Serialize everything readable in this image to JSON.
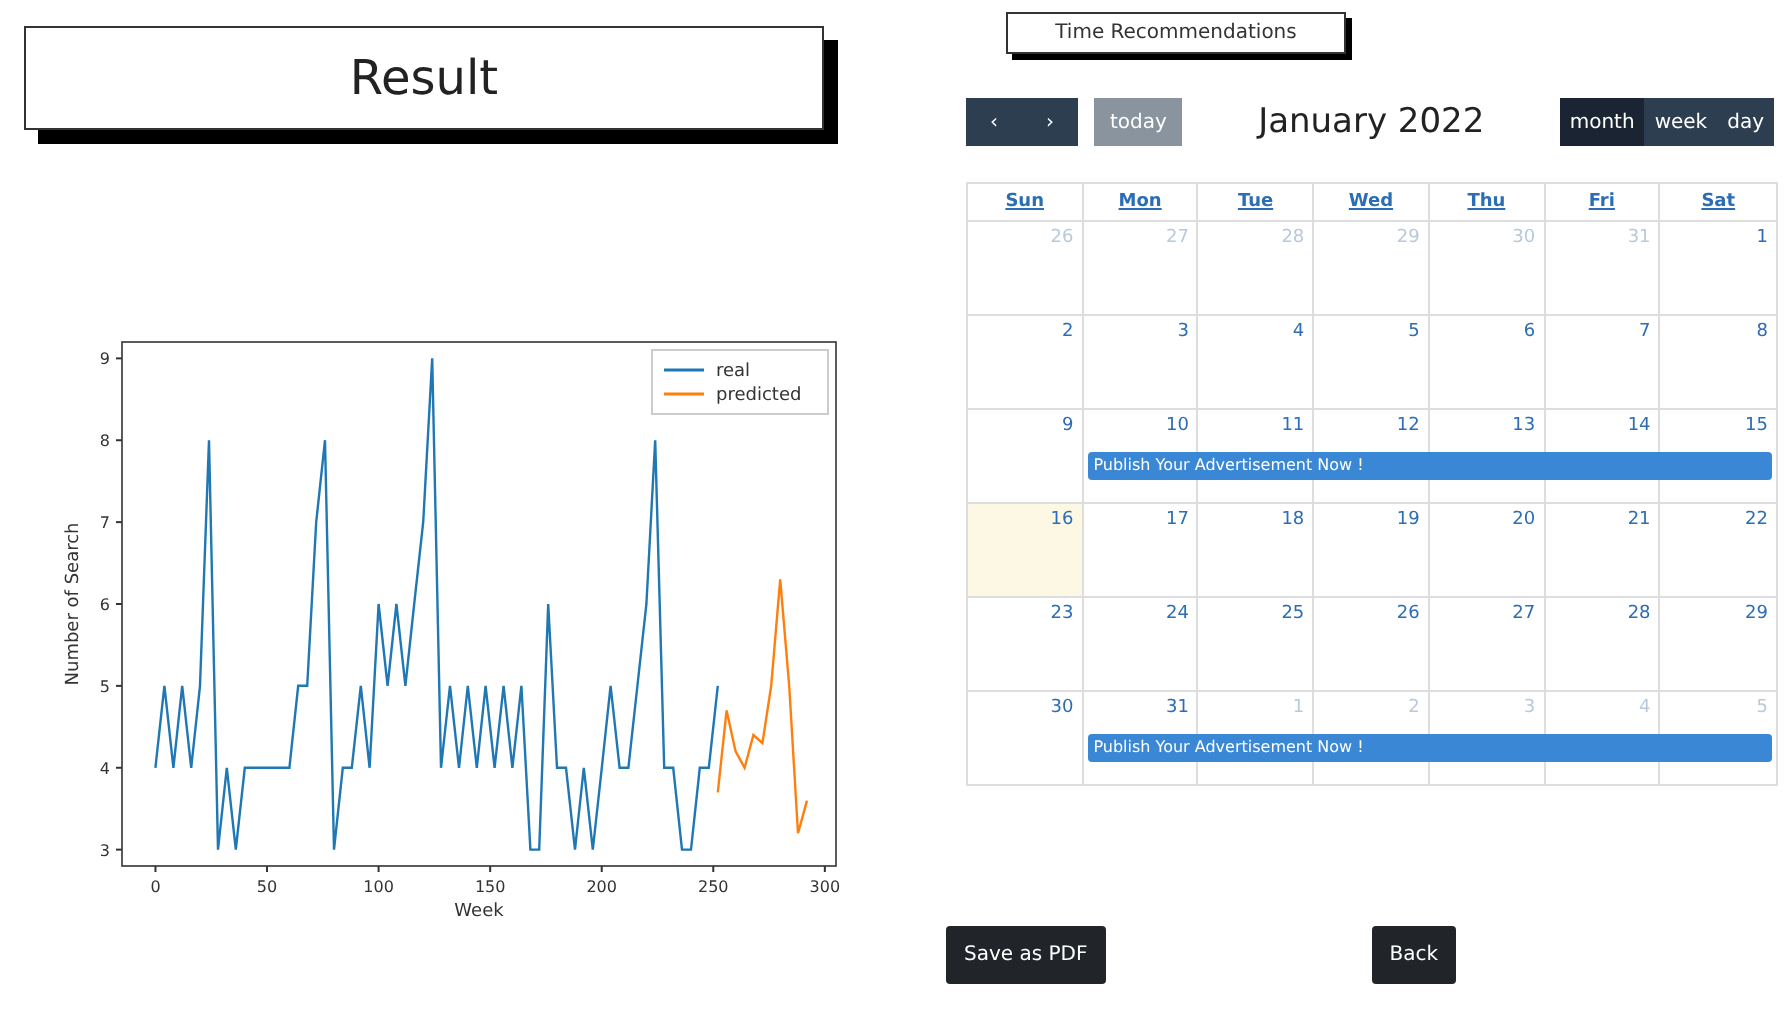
{
  "result_title": "Result",
  "chart": {
    "chart_data": {
      "type": "line",
      "xlabel": "Week",
      "ylabel": "Number of Search",
      "x": [
        0,
        4,
        8,
        12,
        16,
        20,
        24,
        28,
        32,
        36,
        40,
        44,
        48,
        52,
        56,
        60,
        64,
        68,
        72,
        76,
        80,
        84,
        88,
        92,
        96,
        100,
        104,
        108,
        112,
        116,
        120,
        124,
        128,
        132,
        136,
        140,
        144,
        148,
        152,
        156,
        160,
        164,
        168,
        172,
        176,
        180,
        184,
        188,
        192,
        196,
        200,
        204,
        208,
        212,
        216,
        220,
        224,
        228,
        232,
        236,
        240,
        244,
        248,
        252,
        256,
        260,
        264,
        268,
        272,
        276,
        280,
        284,
        288,
        292
      ],
      "series": [
        {
          "name": "real",
          "color": "#1f77b4",
          "values": [
            4,
            5,
            4,
            5,
            4,
            5,
            8,
            3,
            4,
            3,
            4,
            4,
            4,
            4,
            4,
            4,
            5,
            5,
            7,
            8,
            3,
            4,
            4,
            5,
            4,
            6,
            5,
            6,
            5,
            6,
            7,
            9,
            4,
            5,
            4,
            5,
            4,
            5,
            4,
            5,
            4,
            5,
            3,
            3,
            6,
            4,
            4,
            3,
            4,
            3,
            4,
            5,
            4,
            4,
            5,
            6,
            8,
            4,
            4,
            3,
            3,
            4,
            4,
            5,
            null,
            null,
            null,
            null,
            null,
            null,
            null,
            null,
            null,
            null
          ]
        },
        {
          "name": "predicted",
          "color": "#ff7f0e",
          "values": [
            null,
            null,
            null,
            null,
            null,
            null,
            null,
            null,
            null,
            null,
            null,
            null,
            null,
            null,
            null,
            null,
            null,
            null,
            null,
            null,
            null,
            null,
            null,
            null,
            null,
            null,
            null,
            null,
            null,
            null,
            null,
            null,
            null,
            null,
            null,
            null,
            null,
            null,
            null,
            null,
            null,
            null,
            null,
            null,
            null,
            null,
            null,
            null,
            null,
            null,
            null,
            null,
            null,
            null,
            null,
            null,
            null,
            null,
            null,
            null,
            null,
            null,
            null,
            3.7,
            4.7,
            4.2,
            4.0,
            4.4,
            4.3,
            5.0,
            6.3,
            5.0,
            3.2,
            3.6
          ]
        }
      ],
      "legend": "upper right",
      "xlim": [
        -15,
        305
      ],
      "ylim": [
        2.8,
        9.2
      ],
      "xticks": [
        0,
        50,
        100,
        150,
        200,
        250,
        300
      ],
      "yticks": [
        3,
        4,
        5,
        6,
        7,
        8,
        9
      ]
    }
  },
  "recommendations_button": "Time Recommendations",
  "calendar": {
    "prev": "‹",
    "next": "›",
    "today": {
      "label": "today",
      "disabled": true
    },
    "title": "January 2022",
    "views": [
      {
        "label": "month",
        "selected": true
      },
      {
        "label": "week",
        "selected": false
      },
      {
        "label": "day",
        "selected": false
      }
    ],
    "weekdays": [
      "Sun",
      "Mon",
      "Tue",
      "Wed",
      "Thu",
      "Fri",
      "Sat"
    ],
    "weeks": [
      {
        "days": [
          {
            "date": "26",
            "other_month": true,
            "today": false
          },
          {
            "date": "27",
            "other_month": true,
            "today": false
          },
          {
            "date": "28",
            "other_month": true,
            "today": false
          },
          {
            "date": "29",
            "other_month": true,
            "today": false
          },
          {
            "date": "30",
            "other_month": true,
            "today": false
          },
          {
            "date": "31",
            "other_month": true,
            "today": false
          },
          {
            "date": "1",
            "other_month": false,
            "today": false
          }
        ]
      },
      {
        "days": [
          {
            "date": "2",
            "other_month": false,
            "today": false
          },
          {
            "date": "3",
            "other_month": false,
            "today": false
          },
          {
            "date": "4",
            "other_month": false,
            "today": false
          },
          {
            "date": "5",
            "other_month": false,
            "today": false
          },
          {
            "date": "6",
            "other_month": false,
            "today": false
          },
          {
            "date": "7",
            "other_month": false,
            "today": false
          },
          {
            "date": "8",
            "other_month": false,
            "today": false
          }
        ]
      },
      {
        "days": [
          {
            "date": "9",
            "other_month": false,
            "today": false
          },
          {
            "date": "10",
            "other_month": false,
            "today": false,
            "event": "Publish Your Advertisement Now !"
          },
          {
            "date": "11",
            "other_month": false,
            "today": false
          },
          {
            "date": "12",
            "other_month": false,
            "today": false
          },
          {
            "date": "13",
            "other_month": false,
            "today": false
          },
          {
            "date": "14",
            "other_month": false,
            "today": false
          },
          {
            "date": "15",
            "other_month": false,
            "today": false
          }
        ]
      },
      {
        "days": [
          {
            "date": "16",
            "other_month": false,
            "today": true
          },
          {
            "date": "17",
            "other_month": false,
            "today": false
          },
          {
            "date": "18",
            "other_month": false,
            "today": false
          },
          {
            "date": "19",
            "other_month": false,
            "today": false
          },
          {
            "date": "20",
            "other_month": false,
            "today": false
          },
          {
            "date": "21",
            "other_month": false,
            "today": false
          },
          {
            "date": "22",
            "other_month": false,
            "today": false
          }
        ]
      },
      {
        "days": [
          {
            "date": "23",
            "other_month": false,
            "today": false
          },
          {
            "date": "24",
            "other_month": false,
            "today": false
          },
          {
            "date": "25",
            "other_month": false,
            "today": false
          },
          {
            "date": "26",
            "other_month": false,
            "today": false
          },
          {
            "date": "27",
            "other_month": false,
            "today": false
          },
          {
            "date": "28",
            "other_month": false,
            "today": false
          },
          {
            "date": "29",
            "other_month": false,
            "today": false
          }
        ]
      },
      {
        "days": [
          {
            "date": "30",
            "other_month": false,
            "today": false
          },
          {
            "date": "31",
            "other_month": false,
            "today": false,
            "event": "Publish Your Advertisement Now !"
          },
          {
            "date": "1",
            "other_month": true,
            "today": false
          },
          {
            "date": "2",
            "other_month": true,
            "today": false
          },
          {
            "date": "3",
            "other_month": true,
            "today": false
          },
          {
            "date": "4",
            "other_month": true,
            "today": false
          },
          {
            "date": "5",
            "other_month": true,
            "today": false
          }
        ]
      }
    ]
  },
  "buttons": [
    "Save as PDF",
    "Back"
  ]
}
